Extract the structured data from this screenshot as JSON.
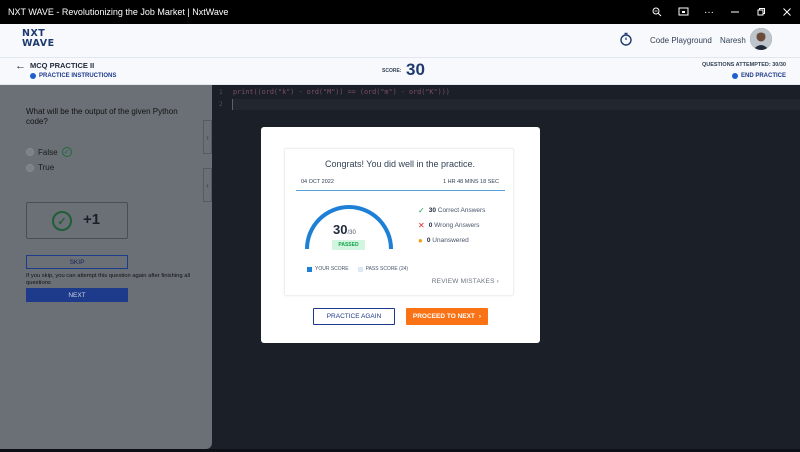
{
  "window": {
    "title": "NXT WAVE - Revolutionizing the Job Market | NxtWave",
    "icons": [
      "zoom-icon",
      "cast-icon",
      "more-icon",
      "minimize-icon",
      "restore-icon",
      "close-icon"
    ]
  },
  "header": {
    "logo_line1": "NXT",
    "logo_line2": "WAVE",
    "logo_sub": "",
    "code_playground": "Code Playground",
    "user_name": "Naresh"
  },
  "subheader": {
    "title": "MCQ PRACTICE II",
    "instructions": "PRACTICE INSTRUCTIONS",
    "score_label": "SCORE:",
    "score_value": "30",
    "attempted": "QUESTIONS ATTEMPTED: 30/30",
    "end_practice": "END PRACTICE"
  },
  "question": {
    "text": "What will be the output of the given Python code?",
    "options": [
      {
        "label": "False",
        "correct": true
      },
      {
        "label": "True",
        "correct": false
      }
    ],
    "points": "+1",
    "skip_label": "SKIP",
    "skip_note": "If you skip, you can attempt this question again after finishing all questions",
    "next_label": "NEXT"
  },
  "editor": {
    "lines": [
      {
        "num": "1",
        "code": "print((ord(\"k\") - ord(\"M\")) == (ord(\"m\") - ord(\"K\")))"
      },
      {
        "num": "2",
        "code": ""
      }
    ]
  },
  "result": {
    "congrats": "Congrats! You did well in the practice.",
    "date": "04 OCT 2022",
    "duration": "1 HR 48 MINS 18 SEC",
    "score": "30",
    "total": "/30",
    "score_fraction": 1.0,
    "status": "PASSED",
    "correct_count": "30",
    "correct_label": "Correct Answers",
    "wrong_count": "0",
    "wrong_label": "Wrong Answers",
    "unanswered_count": "0",
    "unanswered_label": "Unanswered",
    "legend_your": "YOUR SCORE",
    "legend_pass": "PASS SCORE (24)",
    "review": "REVIEW MISTAKES",
    "practice_again": "PRACTICE AGAIN",
    "proceed": "PROCEED TO NEXT"
  },
  "colors": {
    "accent_blue": "#1e3a8a",
    "gauge_blue": "#1d7fd6",
    "pass_green": "#16a34a",
    "proceed_orange": "#f97316"
  }
}
